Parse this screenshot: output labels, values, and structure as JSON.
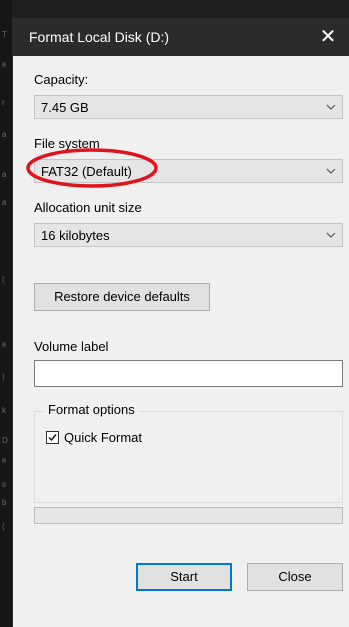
{
  "background": {
    "side_chars": [
      "T",
      "e",
      "r",
      "a",
      "a",
      "a",
      "(",
      "e",
      ")",
      "k",
      "D",
      "e",
      "s",
      "b",
      "("
    ]
  },
  "dialog": {
    "title": "Format Local Disk (D:)",
    "close_glyph": "✕",
    "capacity": {
      "label": "Capacity:",
      "value": "7.45 GB"
    },
    "file_system": {
      "label": "File system",
      "value": "FAT32 (Default)"
    },
    "allocation": {
      "label": "Allocation unit size",
      "value": "16 kilobytes"
    },
    "restore_button": "Restore device defaults",
    "volume_label": {
      "label": "Volume label",
      "value": ""
    },
    "format_options": {
      "title": "Format options",
      "quick_format": {
        "label": "Quick Format",
        "checked": true
      }
    },
    "progress": {
      "value": 0
    },
    "buttons": {
      "start": "Start",
      "close": "Close"
    }
  },
  "annotation": {
    "color": "#e0141e",
    "shape": "ellipse",
    "target": "file-system-select"
  },
  "colors": {
    "titlebar": "#2b2b2b",
    "dialog_bg": "#f0f0f0",
    "accent": "#0078d7"
  }
}
